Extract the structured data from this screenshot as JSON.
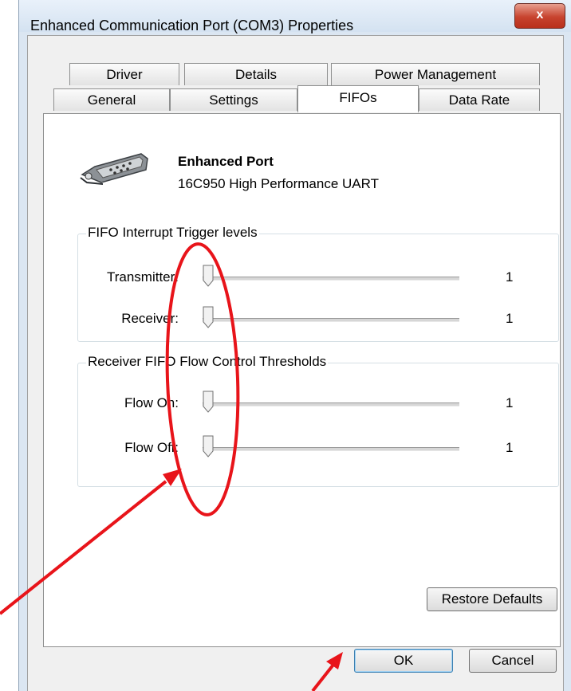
{
  "window": {
    "title": "Enhanced Communication Port (COM3) Properties",
    "close_glyph": "x"
  },
  "tabs": {
    "row_back": [
      "Driver",
      "Details",
      "Power Management"
    ],
    "row_front": [
      "General",
      "Settings",
      "FIFOs",
      "Data Rate"
    ],
    "active": "FIFOs"
  },
  "port": {
    "icon": "serial-port-icon",
    "name": "Enhanced Port",
    "description": "16C950 High Performance UART"
  },
  "groups": [
    {
      "title": "FIFO Interrupt Trigger levels",
      "sliders": [
        {
          "label": "Transmitter:",
          "value": "1",
          "position": 0
        },
        {
          "label": "Receiver:",
          "value": "1",
          "position": 0
        }
      ]
    },
    {
      "title": "Receiver FIFO Flow Control Thresholds",
      "sliders": [
        {
          "label": "Flow On:",
          "value": "1",
          "position": 0
        },
        {
          "label": "Flow Off:",
          "value": "1",
          "position": 0
        }
      ]
    }
  ],
  "buttons": {
    "restore_defaults": "Restore Defaults",
    "ok": "OK",
    "cancel": "Cancel"
  },
  "colors": {
    "annotation": "#e8141a",
    "close_button": "#c7432e"
  }
}
